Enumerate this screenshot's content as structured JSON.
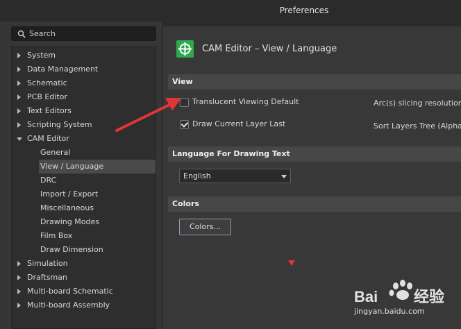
{
  "window": {
    "title": "Preferences"
  },
  "search": {
    "label": "Search"
  },
  "tree": {
    "items": [
      {
        "label": "System",
        "expanded": false,
        "level": 0
      },
      {
        "label": "Data Management",
        "expanded": false,
        "level": 0
      },
      {
        "label": "Schematic",
        "expanded": false,
        "level": 0
      },
      {
        "label": "PCB Editor",
        "expanded": false,
        "level": 0
      },
      {
        "label": "Text Editors",
        "expanded": false,
        "level": 0
      },
      {
        "label": "Scripting System",
        "expanded": false,
        "level": 0
      },
      {
        "label": "CAM Editor",
        "expanded": true,
        "level": 0
      },
      {
        "label": "General",
        "level": 1
      },
      {
        "label": "View / Language",
        "level": 1,
        "selected": true
      },
      {
        "label": "DRC",
        "level": 1
      },
      {
        "label": "Import / Export",
        "level": 1
      },
      {
        "label": "Miscellaneous",
        "level": 1
      },
      {
        "label": "Drawing Modes",
        "level": 1
      },
      {
        "label": "Film Box",
        "level": 1
      },
      {
        "label": "Draw Dimension",
        "level": 1
      },
      {
        "label": "Simulation",
        "expanded": false,
        "level": 0
      },
      {
        "label": "Draftsman",
        "expanded": false,
        "level": 0
      },
      {
        "label": "Multi-board Schematic",
        "expanded": false,
        "level": 0
      },
      {
        "label": "Multi-board Assembly",
        "expanded": false,
        "level": 0
      }
    ]
  },
  "page": {
    "title": "CAM Editor – View / Language",
    "sections": {
      "view": "View",
      "language": "Language For Drawing Text",
      "colors": "Colors"
    },
    "options": {
      "translucent": {
        "label": "Translucent Viewing Default",
        "checked": false
      },
      "draw_current_layer": {
        "label": "Draw Current Layer Last",
        "checked": true
      },
      "arc_slicing": {
        "label": "Arc(s) slicing resolution ("
      },
      "sort_layers": {
        "label": "Sort Layers Tree (Alphabe"
      }
    },
    "language_select": {
      "value": "English"
    },
    "colors_button": {
      "label": "Colors..."
    }
  },
  "watermark": {
    "text": "jingyan.baidu.com"
  },
  "colors": {
    "accent_green": "#2fa84f",
    "annotation_red": "#e23636"
  }
}
